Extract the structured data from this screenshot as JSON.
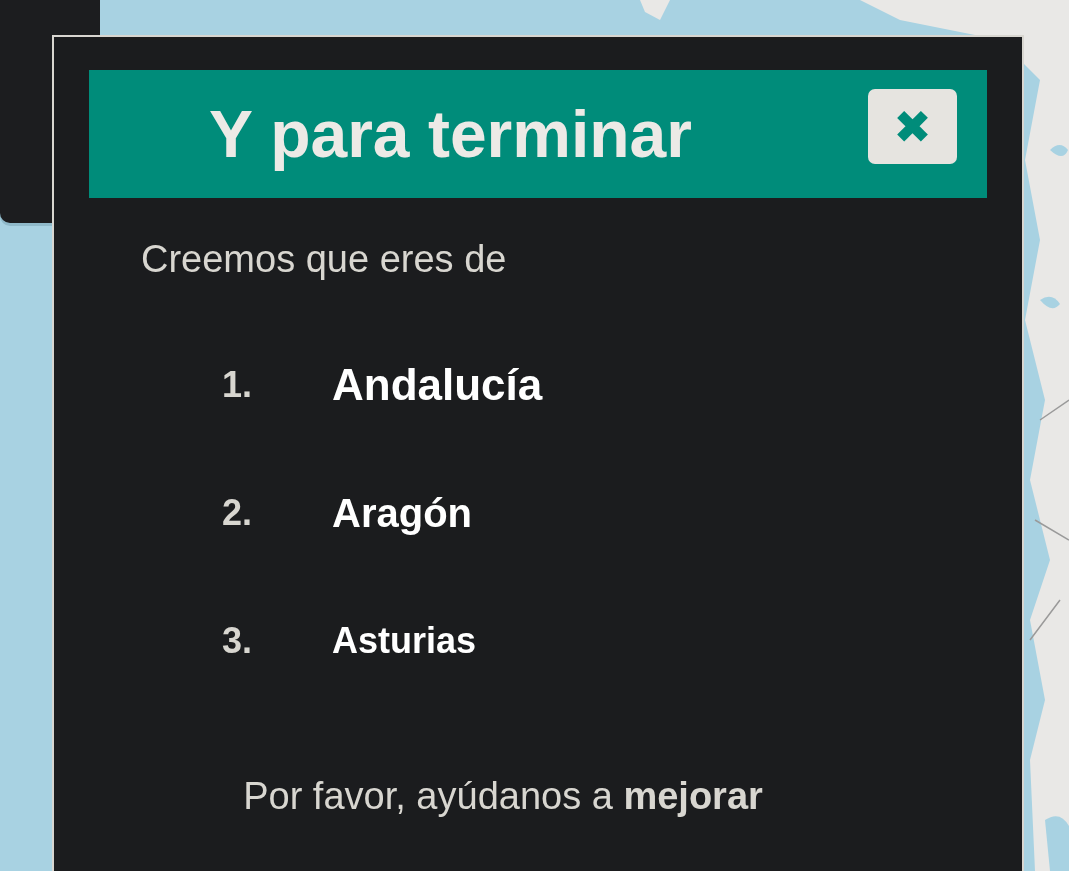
{
  "dialog": {
    "title": "Y para terminar",
    "close_icon": "✖",
    "intro": "Creemos que eres de",
    "regions": [
      {
        "number": "1.",
        "name": "Andalucía"
      },
      {
        "number": "2.",
        "name": "Aragón"
      },
      {
        "number": "3.",
        "name": "Asturias"
      }
    ],
    "request": "Por favor, ayúdanos a **mejorar**"
  }
}
